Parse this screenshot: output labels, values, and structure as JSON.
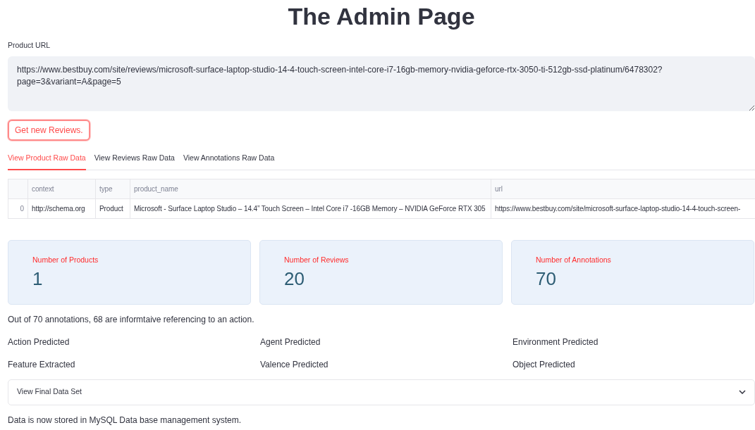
{
  "title": "The Admin Page",
  "url_field": {
    "label": "Product URL",
    "value": "https://www.bestbuy.com/site/reviews/microsoft-surface-laptop-studio-14-4-touch-screen-intel-core-i7-16gb-memory-nvidia-geforce-rtx-3050-ti-512gb-ssd-platinum/6478302?page=3&variant=A&page=5"
  },
  "button": "Get new Reviews.",
  "tabs": [
    {
      "label": "View Product Raw Data",
      "selected": true
    },
    {
      "label": "View Reviews Raw Data",
      "selected": false
    },
    {
      "label": "View Annotations Raw Data",
      "selected": false
    }
  ],
  "table": {
    "columns": [
      "context",
      "type",
      "product_name",
      "url"
    ],
    "rows": [
      {
        "index": "0",
        "cells": [
          "http://schema.org",
          "Product",
          "Microsoft - Surface Laptop Studio – 14.4” Touch Screen – Intel Core i7 -16GB Memory – NVIDIA GeForce RTX 305",
          "https://www.bestbuy.com/site/microsoft-surface-laptop-studio-14-4-touch-screen-"
        ]
      }
    ]
  },
  "metrics": [
    {
      "label": "Number of Products",
      "value": "1"
    },
    {
      "label": "Number of Reviews",
      "value": "20"
    },
    {
      "label": "Number of Annotations",
      "value": "70"
    }
  ],
  "summary": "Out of 70 annotations, 68 are informtaive referencing to an action.",
  "predictions": [
    "Action Predicted",
    "Agent Predicted",
    "Environment Predicted",
    "Feature Extracted",
    "Valence Predicted",
    "Object Predicted"
  ],
  "expander": {
    "label": "View Final Data Set",
    "expanded": false
  },
  "footer": "Data is now stored in MySQL Data base management system."
}
